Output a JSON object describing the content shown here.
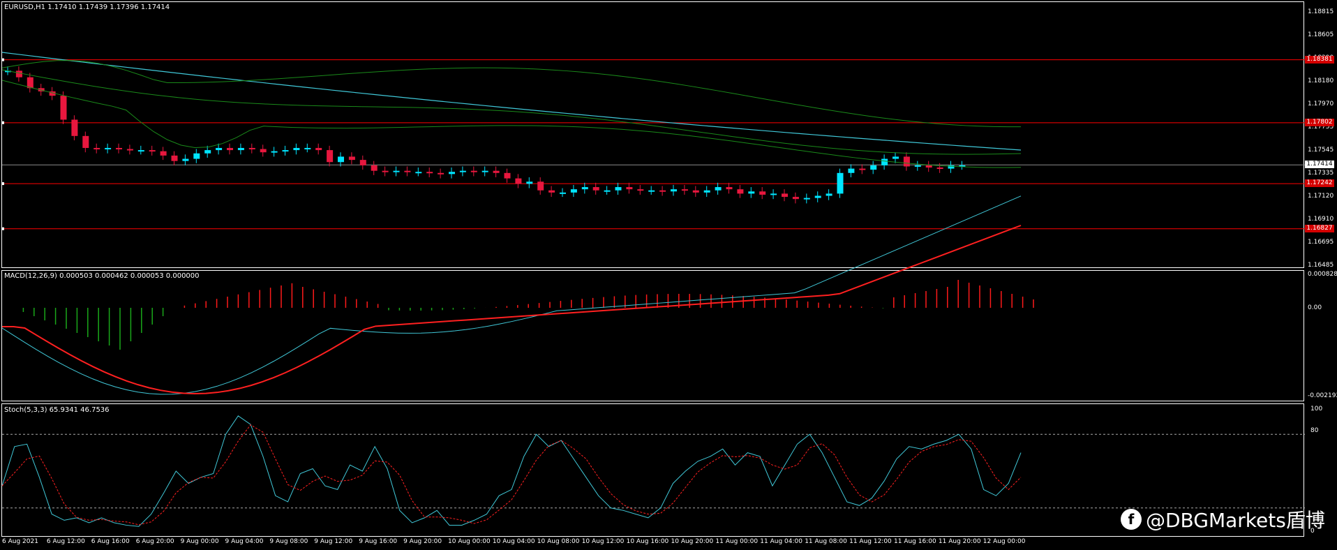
{
  "symbol_header": "EURUSD,H1  1.17410 1.17439 1.17396 1.17414",
  "macd_header": "MACD(12,26,9) 0.000503 0.000462 0.000053 0.000000",
  "stoch_header": "Stoch(5,3,3) 65.9341 46.7536",
  "price_scale": [
    "1.18815",
    "1.18605",
    "1.18390",
    "1.18180",
    "1.17970",
    "1.17755",
    "1.17545",
    "1.17335",
    "1.17120",
    "1.16910",
    "1.16695",
    "1.16485"
  ],
  "price_tags": [
    {
      "value": "1.18381",
      "kind": "level"
    },
    {
      "value": "1.17802",
      "kind": "level"
    },
    {
      "value": "1.17414",
      "kind": "current"
    },
    {
      "value": "1.17242",
      "kind": "level"
    },
    {
      "value": "1.16827",
      "kind": "level"
    }
  ],
  "macd_scale": [
    "0.000828",
    "0.00",
    "-0.002192"
  ],
  "stoch_scale": [
    "100",
    "80",
    "0"
  ],
  "time_labels": [
    "6 Aug 2021",
    "6 Aug 12:00",
    "6 Aug 16:00",
    "6 Aug 20:00",
    "9 Aug 00:00",
    "9 Aug 04:00",
    "9 Aug 08:00",
    "9 Aug 12:00",
    "9 Aug 16:00",
    "9 Aug 20:00",
    "10 Aug 00:00",
    "10 Aug 04:00",
    "10 Aug 08:00",
    "10 Aug 12:00",
    "10 Aug 16:00",
    "10 Aug 20:00",
    "11 Aug 00:00",
    "11 Aug 04:00",
    "11 Aug 08:00",
    "11 Aug 12:00",
    "11 Aug 16:00",
    "11 Aug 20:00",
    "12 Aug 00:00"
  ],
  "watermark": "@DBGMarkets盾博",
  "colors": {
    "bull": "#00e5ff",
    "bear": "#e8173e",
    "level": "#ff0000",
    "ma": "#40c8d8",
    "band": "#1a8a1a",
    "macd_pos": "#ff1a1a",
    "macd_neg": "#1aa81a",
    "signal": "#ff2020"
  },
  "chart_data": {
    "type": "candlestick",
    "candles_close": [
      1.1828,
      1.1822,
      1.1812,
      1.1809,
      1.1805,
      1.1783,
      1.1768,
      1.1757,
      1.1756,
      1.1757,
      1.1756,
      1.1755,
      1.1755,
      1.1754,
      1.175,
      1.1745,
      1.1747,
      1.1752,
      1.1755,
      1.1757,
      1.1755,
      1.1757,
      1.1756,
      1.1753,
      1.1754,
      1.1755,
      1.1757,
      1.1757,
      1.1755,
      1.1744,
      1.1749,
      1.1746,
      1.1741,
      1.1736,
      1.1735,
      1.1736,
      1.1735,
      1.1735,
      1.1734,
      1.1733,
      1.1735,
      1.1736,
      1.1735,
      1.1736,
      1.1734,
      1.1729,
      1.1724,
      1.1726,
      1.1718,
      1.1716,
      1.1716,
      1.1719,
      1.1721,
      1.1718,
      1.1718,
      1.1721,
      1.1719,
      1.1718,
      1.1718,
      1.1717,
      1.1719,
      1.1718,
      1.1716,
      1.1718,
      1.1721,
      1.1719,
      1.1715,
      1.1717,
      1.1714,
      1.1715,
      1.1712,
      1.171,
      1.1711,
      1.1713,
      1.1715,
      1.1734,
      1.1738,
      1.1737,
      1.1741,
      1.1747,
      1.1749,
      1.174,
      1.1741,
      1.1739,
      1.1738,
      1.1741,
      1.1741
    ],
    "macd_main_sign": "see histogram",
    "stoch_k_last": 65.9341,
    "stoch_d_last": 46.7536
  }
}
